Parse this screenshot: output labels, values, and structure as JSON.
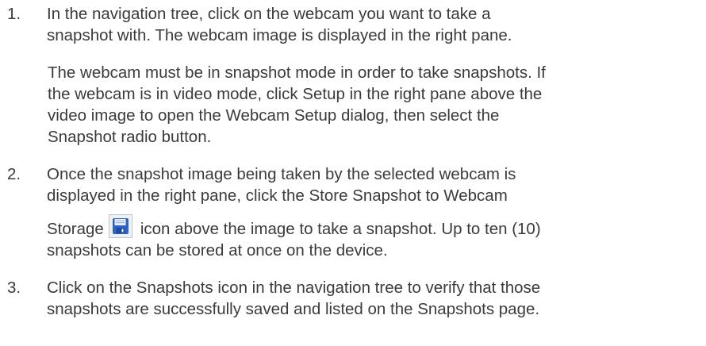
{
  "steps": [
    {
      "number": "1.",
      "lines": [
        "In the navigation tree, click on the webcam you want to take a",
        "snapshot with. The webcam image is displayed in the right pane."
      ]
    },
    {
      "number": "2.",
      "lines": [
        "Once the snapshot image being taken by the selected webcam is",
        "displayed in the right pane, click the Store Snapshot to Webcam"
      ],
      "icon_line_before": "Storage",
      "icon_line_after": "icon above the image to take a snapshot. Up to ten (10)",
      "last_line": "snapshots can be stored at once on the device.",
      "icon": "save-snapshot-icon"
    },
    {
      "number": "3.",
      "lines": [
        "Click on the Snapshots icon in the navigation tree to verify that those",
        "snapshots are successfully saved and listed on the Snapshots page."
      ]
    }
  ],
  "note": {
    "lines": [
      "The webcam must be in snapshot mode in order to take snapshots. If",
      "the webcam is in video mode, click Setup in the right pane above the",
      "video image to open the Webcam Setup dialog, then select the",
      "Snapshot radio button."
    ]
  },
  "colors": {
    "text": "#3b3b3b",
    "icon_blue": "#2b63c6"
  }
}
